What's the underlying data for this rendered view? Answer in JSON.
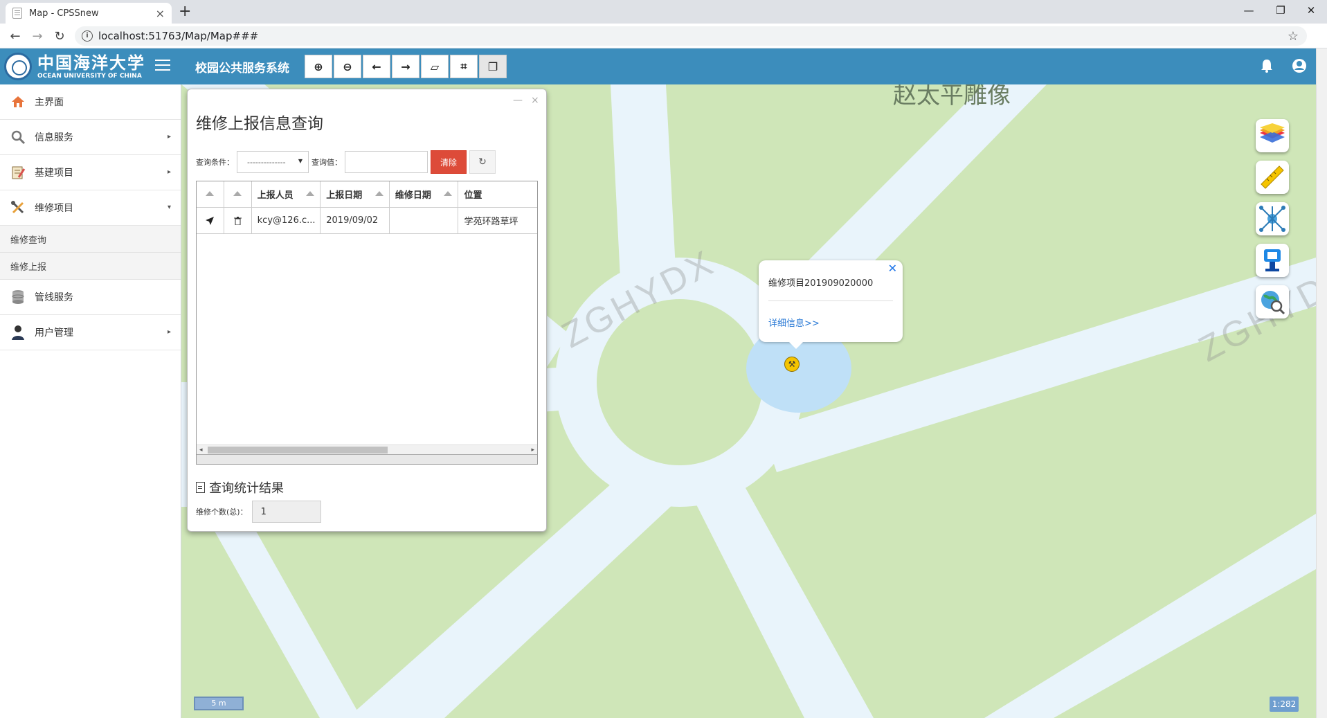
{
  "browser": {
    "tab_title": "Map - CPSSnew",
    "tab_close": "×",
    "new_tab": "+",
    "url": "localhost:51763/Map/Map###",
    "win_minimize": "—",
    "win_restore": "❐",
    "win_close": "✕"
  },
  "header": {
    "logo_cn": "中国海洋大学",
    "logo_en": "OCEAN UNIVERSITY OF CHINA",
    "title": "校园公共服务系统",
    "toolbar": [
      {
        "icon": "zoom-in-icon",
        "glyph": "⊕"
      },
      {
        "icon": "zoom-out-icon",
        "glyph": "⊖"
      },
      {
        "icon": "arrow-left-icon",
        "glyph": "←"
      },
      {
        "icon": "arrow-right-icon",
        "glyph": "→"
      },
      {
        "icon": "map-icon",
        "glyph": "▱"
      },
      {
        "icon": "crop-icon",
        "glyph": "⌗"
      },
      {
        "icon": "copy-icon",
        "glyph": "❐"
      }
    ],
    "bell_glyph": "🔔",
    "user_glyph": "●",
    "color_primary": "#3c8dbc"
  },
  "sidebar": {
    "items": [
      {
        "label": "主界面",
        "icon": "home-icon"
      },
      {
        "label": "信息服务",
        "icon": "search-icon",
        "caret": "▸"
      },
      {
        "label": "基建项目",
        "icon": "notepad-icon",
        "caret": "▸"
      },
      {
        "label": "维修项目",
        "icon": "tools-icon",
        "caret": "▾"
      },
      {
        "label": "管线服务",
        "icon": "database-icon"
      },
      {
        "label": "用户管理",
        "icon": "user-icon",
        "caret": "▸"
      }
    ],
    "submenu": [
      "维修查询",
      "维修上报"
    ]
  },
  "map": {
    "place_label": "赵太平雕像",
    "watermark": "ZGHYDX",
    "scale_text": "5 m",
    "zoom_ratio": "1:282",
    "popup": {
      "close": "✕",
      "title": "维修项目201909020000",
      "link": "详细信息>>"
    },
    "tools": [
      "layers-icon",
      "ruler-icon",
      "network-icon",
      "robot-icon",
      "globe-search-icon"
    ]
  },
  "panel": {
    "title": "维修上报信息查询",
    "minimize": "—",
    "close": "×",
    "query_condition_label": "查询条件：",
    "query_condition_value": "--------------",
    "query_value_label": "查询值：",
    "query_value": "",
    "clear_button": "清除",
    "refresh_glyph": "↻",
    "columns": [
      "",
      "",
      "上报人员",
      "上报日期",
      "维修日期",
      "位置"
    ],
    "rows": [
      {
        "locate": "➤",
        "delete": "🗑",
        "reporter": "kcy@126.c...",
        "report_date": "2019/09/02",
        "repair_date": "",
        "location": "学苑环路草坪"
      }
    ],
    "stat_title": "查询统计结果",
    "stat_label": "维修个数(总)：",
    "stat_value": "1"
  }
}
